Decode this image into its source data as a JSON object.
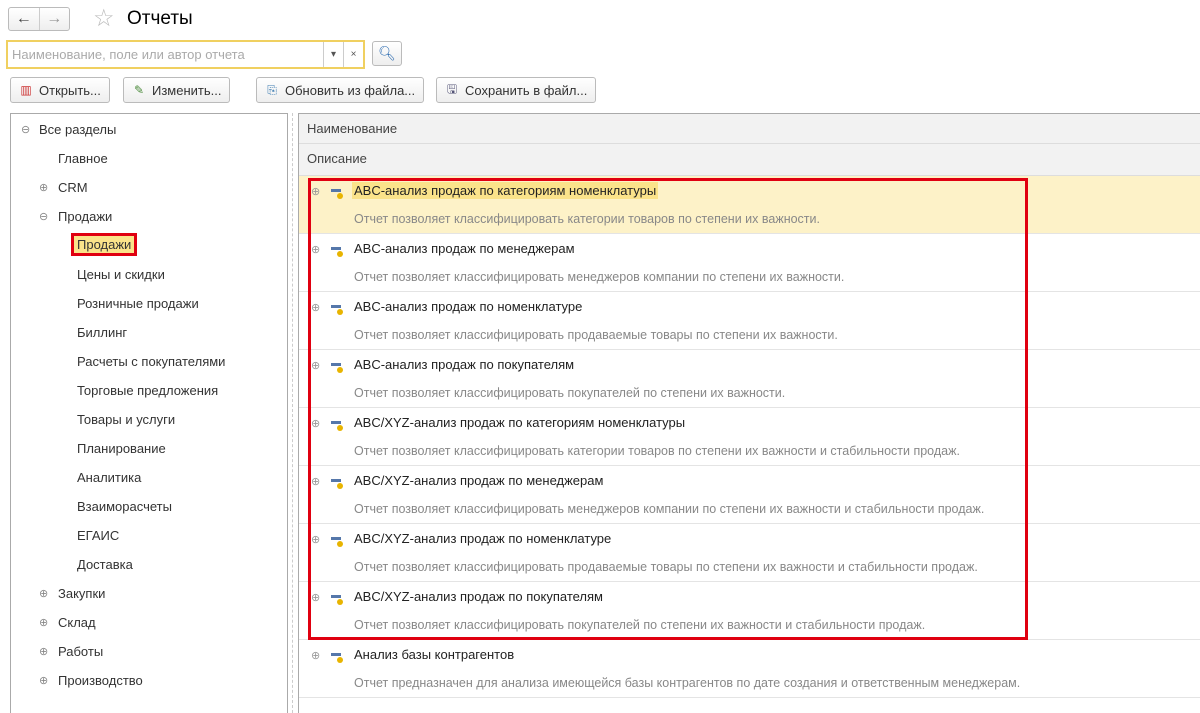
{
  "header": {
    "title": "Отчеты",
    "back": "←",
    "forward": "→"
  },
  "search": {
    "placeholder": "Наименование, поле или автор отчета",
    "dropdown": "▾",
    "clear": "×"
  },
  "toolbar": {
    "open": "Открыть...",
    "edit": "Изменить...",
    "update": "Обновить из файла...",
    "save": "Сохранить в файл..."
  },
  "sidebar": {
    "root": "Все разделы",
    "items": [
      {
        "label": "Главное",
        "level": 1,
        "toggle": ""
      },
      {
        "label": "CRM",
        "level": 1,
        "toggle": "⊕"
      },
      {
        "label": "Продажи",
        "level": 1,
        "toggle": "⊖"
      },
      {
        "label": "Продажи",
        "level": 2,
        "toggle": "",
        "selected": true
      },
      {
        "label": "Цены и скидки",
        "level": 2,
        "toggle": ""
      },
      {
        "label": "Розничные продажи",
        "level": 2,
        "toggle": ""
      },
      {
        "label": "Биллинг",
        "level": 2,
        "toggle": ""
      },
      {
        "label": "Расчеты с покупателями",
        "level": 2,
        "toggle": ""
      },
      {
        "label": "Торговые предложения",
        "level": 2,
        "toggle": ""
      },
      {
        "label": "Товары и услуги",
        "level": 2,
        "toggle": ""
      },
      {
        "label": "Планирование",
        "level": 2,
        "toggle": ""
      },
      {
        "label": "Аналитика",
        "level": 2,
        "toggle": ""
      },
      {
        "label": "Взаиморасчеты",
        "level": 2,
        "toggle": ""
      },
      {
        "label": "ЕГАИС",
        "level": 2,
        "toggle": ""
      },
      {
        "label": "Доставка",
        "level": 2,
        "toggle": ""
      },
      {
        "label": "Закупки",
        "level": 1,
        "toggle": "⊕"
      },
      {
        "label": "Склад",
        "level": 1,
        "toggle": "⊕"
      },
      {
        "label": "Работы",
        "level": 1,
        "toggle": "⊕"
      },
      {
        "label": "Производство",
        "level": 1,
        "toggle": "⊕"
      }
    ]
  },
  "table": {
    "col_name": "Наименование",
    "col_desc": "Описание",
    "rows": [
      {
        "name": "ABC-анализ продаж по категориям номенклатуры",
        "desc": "Отчет позволяет классифицировать категории товаров по степени их важности."
      },
      {
        "name": "ABC-анализ продаж по менеджерам",
        "desc": "Отчет позволяет классифицировать менеджеров компании по степени их важности."
      },
      {
        "name": "ABC-анализ продаж по номенклатуре",
        "desc": "Отчет позволяет классифицировать продаваемые товары по степени их важности."
      },
      {
        "name": "ABC-анализ продаж по покупателям",
        "desc": "Отчет позволяет классифицировать покупателей по степени их важности."
      },
      {
        "name": "ABC/XYZ-анализ продаж по категориям номенклатуры",
        "desc": "Отчет позволяет классифицировать категории товаров по степени их важности и стабильности продаж."
      },
      {
        "name": "ABC/XYZ-анализ продаж по менеджерам",
        "desc": "Отчет позволяет классифицировать менеджеров компании по степени их важности и стабильности продаж."
      },
      {
        "name": "ABC/XYZ-анализ продаж по номенклатуре",
        "desc": "Отчет позволяет классифицировать продаваемые товары по степени их важности и стабильности продаж."
      },
      {
        "name": "ABC/XYZ-анализ продаж по покупателям",
        "desc": "Отчет позволяет классифицировать покупателей по степени их важности и стабильности продаж."
      },
      {
        "name": "Анализ базы контрагентов",
        "desc": "Отчет предназначен для анализа имеющейся базы контрагентов по дате создания и ответственным менеджерам."
      }
    ]
  },
  "colors": {
    "highlight": "#fbe38a",
    "annotation": "#e00010",
    "search_border": "#f0d060"
  }
}
